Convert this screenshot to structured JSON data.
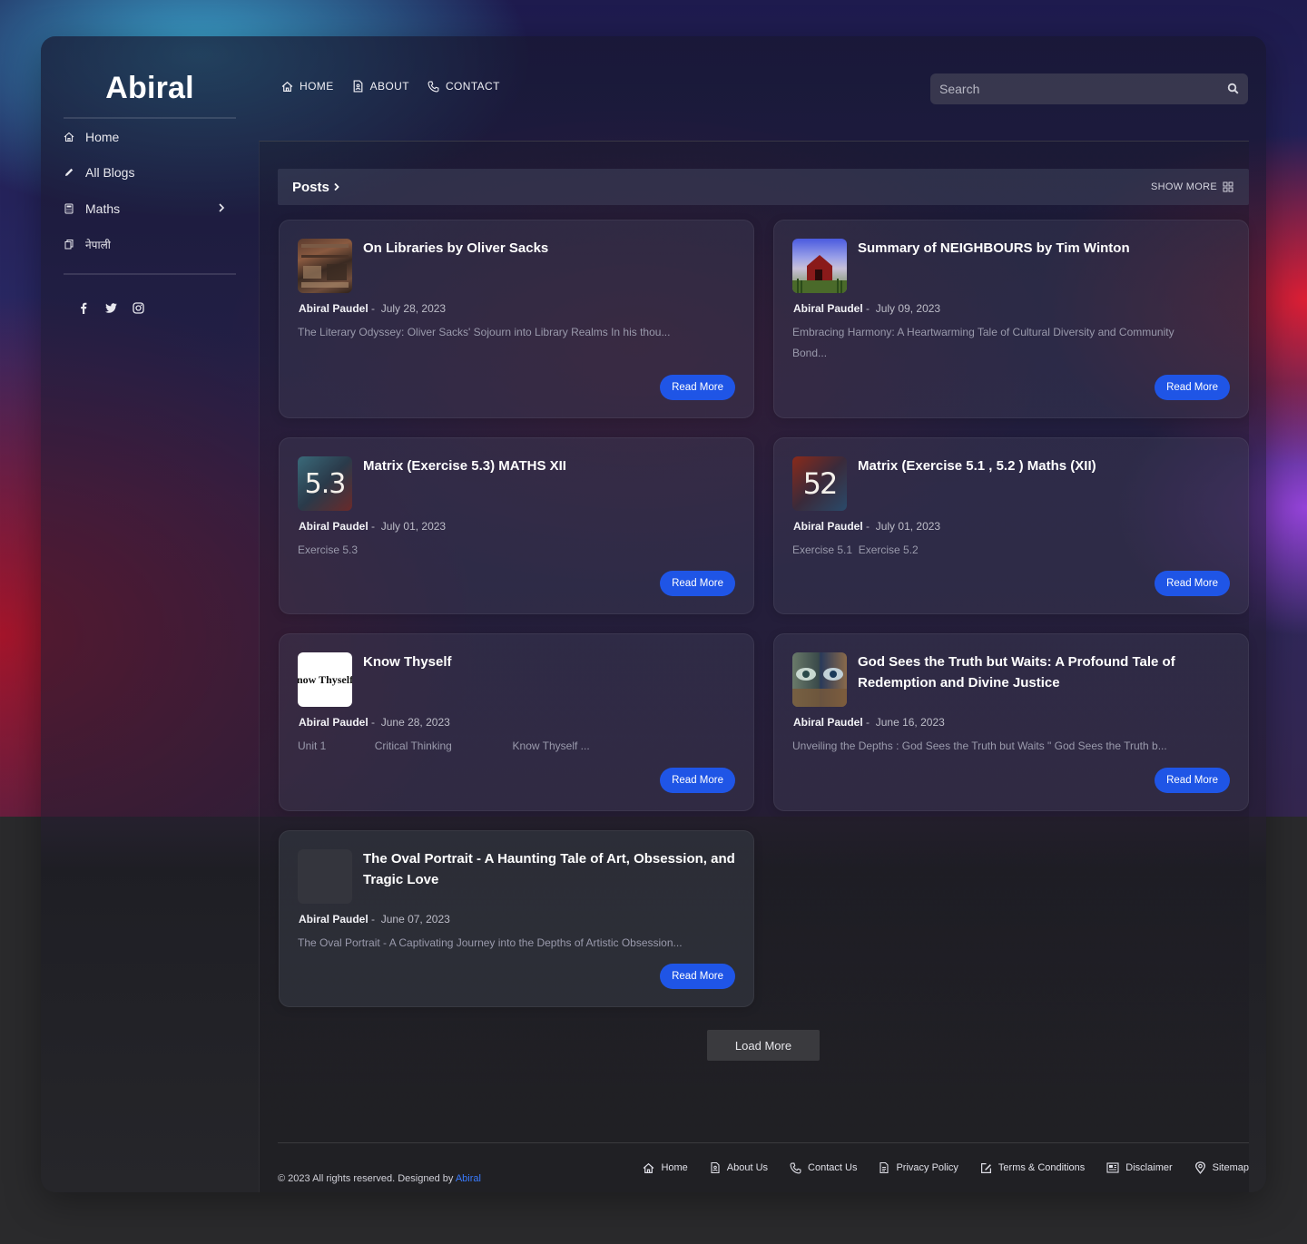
{
  "brand": "Abiral",
  "sidebar": {
    "items": [
      {
        "label": "Home",
        "icon": "home-icon"
      },
      {
        "label": "All Blogs",
        "icon": "pencil-icon"
      },
      {
        "label": "Maths",
        "icon": "calculator-icon"
      },
      {
        "label": "नेपाली",
        "icon": "copy-icon"
      }
    ],
    "social": [
      "facebook-icon",
      "twitter-icon",
      "instagram-icon"
    ]
  },
  "topnav": {
    "items": [
      {
        "label": "HOME",
        "icon": "home-icon"
      },
      {
        "label": "ABOUT",
        "icon": "contact-card-icon"
      },
      {
        "label": "CONTACT",
        "icon": "phone-icon"
      }
    ]
  },
  "search": {
    "placeholder": "Search"
  },
  "posts_section": {
    "title": "Posts",
    "show_more": "SHOW MORE"
  },
  "posts": [
    {
      "title": "On Libraries by Oliver Sacks",
      "author": "Abiral Paudel",
      "date": "July 28, 2023",
      "excerpt": "The Literary Odyssey: Oliver Sacks' Sojourn into Library Realms In his thou...",
      "read_more": "Read More"
    },
    {
      "title": "Summary of NEIGHBOURS by Tim Winton",
      "author": "Abiral Paudel",
      "date": "July 09, 2023",
      "excerpt": "Embracing Harmony: A Heartwarming Tale of Cultural Diversity and Community Bond...",
      "read_more": "Read More"
    },
    {
      "title": "Matrix (Exercise 5.3) MATHS XII",
      "author": "Abiral Paudel",
      "date": "July 01, 2023",
      "excerpt": "Exercise 5.3",
      "read_more": "Read More",
      "thumb_text": "5.3"
    },
    {
      "title": "Matrix (Exercise 5.1 , 5.2 ) Maths (XII)",
      "author": "Abiral Paudel",
      "date": "July 01, 2023",
      "excerpt": "Exercise 5.1  Exercise 5.2",
      "read_more": "Read More",
      "thumb_text": "52"
    },
    {
      "title": "Know Thyself",
      "author": "Abiral Paudel",
      "date": "June 28, 2023",
      "excerpt": "Unit 1                Critical Thinking                    Know Thyself ...",
      "read_more": "Read More",
      "thumb_text": "now Thyself"
    },
    {
      "title": "God Sees the Truth but Waits: A Profound Tale of Redemption and Divine Justice",
      "author": "Abiral Paudel",
      "date": "June 16, 2023",
      "excerpt": "Unveiling the Depths : God Sees the Truth but Waits \" God Sees the Truth b...",
      "read_more": "Read More"
    },
    {
      "title": "The Oval Portrait - A Haunting Tale of Art, Obsession, and Tragic Love",
      "author": "Abiral Paudel",
      "date": "June 07, 2023",
      "excerpt": "The Oval Portrait - A Captivating Journey into the Depths of Artistic Obsession...",
      "read_more": "Read More"
    }
  ],
  "load_more": "Load More",
  "footer": {
    "copyright": "© 2023 All rights reserved. Designed by",
    "designer": "Abiral",
    "links": [
      {
        "label": "Home",
        "icon": "home-icon"
      },
      {
        "label": "About Us",
        "icon": "contact-card-icon"
      },
      {
        "label": "Contact Us",
        "icon": "phone-icon"
      },
      {
        "label": "Privacy Policy",
        "icon": "document-icon"
      },
      {
        "label": "Terms & Conditions",
        "icon": "edit-icon"
      },
      {
        "label": "Disclaimer",
        "icon": "newspaper-icon"
      },
      {
        "label": "Sitemap",
        "icon": "map-pin-icon"
      }
    ]
  },
  "colors": {
    "accent": "#1f55e6",
    "link": "#3a7bff",
    "page_bottom": "#2a2a2c"
  }
}
